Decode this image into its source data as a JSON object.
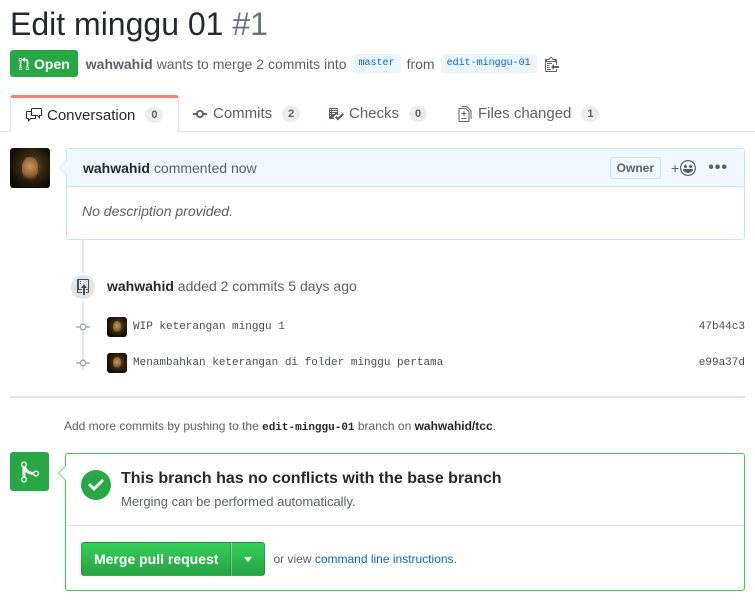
{
  "pr": {
    "title": "Edit minggu 01",
    "number": "#1",
    "state": "Open",
    "author": "wahwahid",
    "merge_text": "wants to merge 2 commits into",
    "base_branch": "master",
    "from_text": "from",
    "head_branch": "edit-minggu-01"
  },
  "tabs": [
    {
      "label": "Conversation",
      "count": "0",
      "icon": "comment-discussion-icon"
    },
    {
      "label": "Commits",
      "count": "2",
      "icon": "git-commit-icon"
    },
    {
      "label": "Checks",
      "count": "0",
      "icon": "checklist-icon"
    },
    {
      "label": "Files changed",
      "count": "1",
      "icon": "file-diff-icon"
    }
  ],
  "comment": {
    "author": "wahwahid",
    "action": "commented now",
    "owner_label": "Owner",
    "reaction_plus": "+",
    "menu": "•••",
    "body": "No description provided."
  },
  "timeline": {
    "author": "wahwahid",
    "action": "added 2 commits 5 days ago",
    "commits": [
      {
        "message": "WIP keterangan minggu 1",
        "sha": "47b44c3"
      },
      {
        "message": "Menambahkan keterangan di folder minggu pertama",
        "sha": "e99a37d"
      }
    ]
  },
  "push_hint": {
    "prefix": "Add more commits by pushing to the",
    "branch": "edit-minggu-01",
    "middle": "branch on",
    "repo": "wahwahid/tcc",
    "suffix": "."
  },
  "merge": {
    "status_title": "This branch has no conflicts with the base branch",
    "status_sub": "Merging can be performed automatically.",
    "button_label": "Merge pull request",
    "or_view": "or view",
    "cli_link": "command line instructions",
    "cli_suffix": "."
  },
  "colors": {
    "green": "#28a745",
    "blue_link": "#0366d6",
    "tab_accent": "#f9826c"
  }
}
